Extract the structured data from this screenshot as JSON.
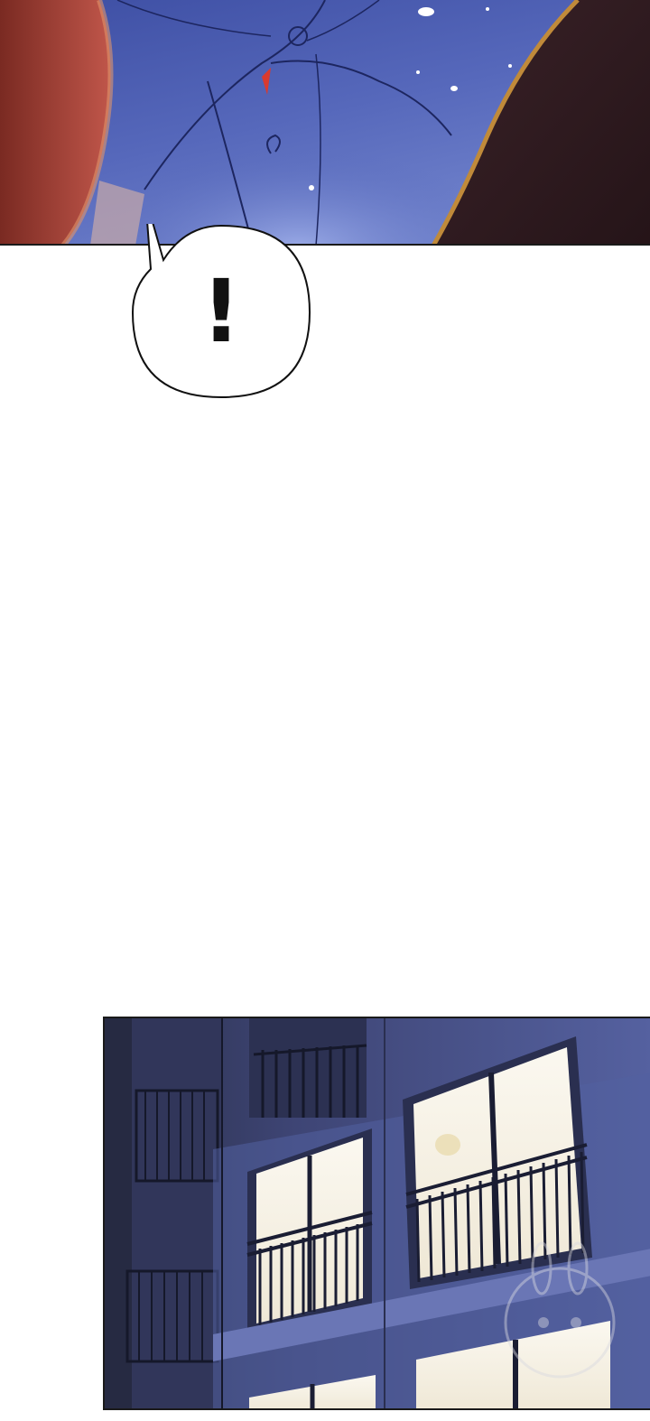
{
  "panels": [
    {
      "name": "closeup-panel",
      "scene": "blue-fabric-closeup"
    },
    {
      "name": "apartment-night-panel",
      "scene": "apartment-exterior-night"
    }
  ],
  "speech_bubble": {
    "text": "!"
  },
  "colors": {
    "fabric_blue": "#4a5db0",
    "fabric_highlight": "#8fa0e0",
    "night_wall": "#4b5590",
    "window_glow": "#f4efe4",
    "ink": "#1a1a1a"
  }
}
